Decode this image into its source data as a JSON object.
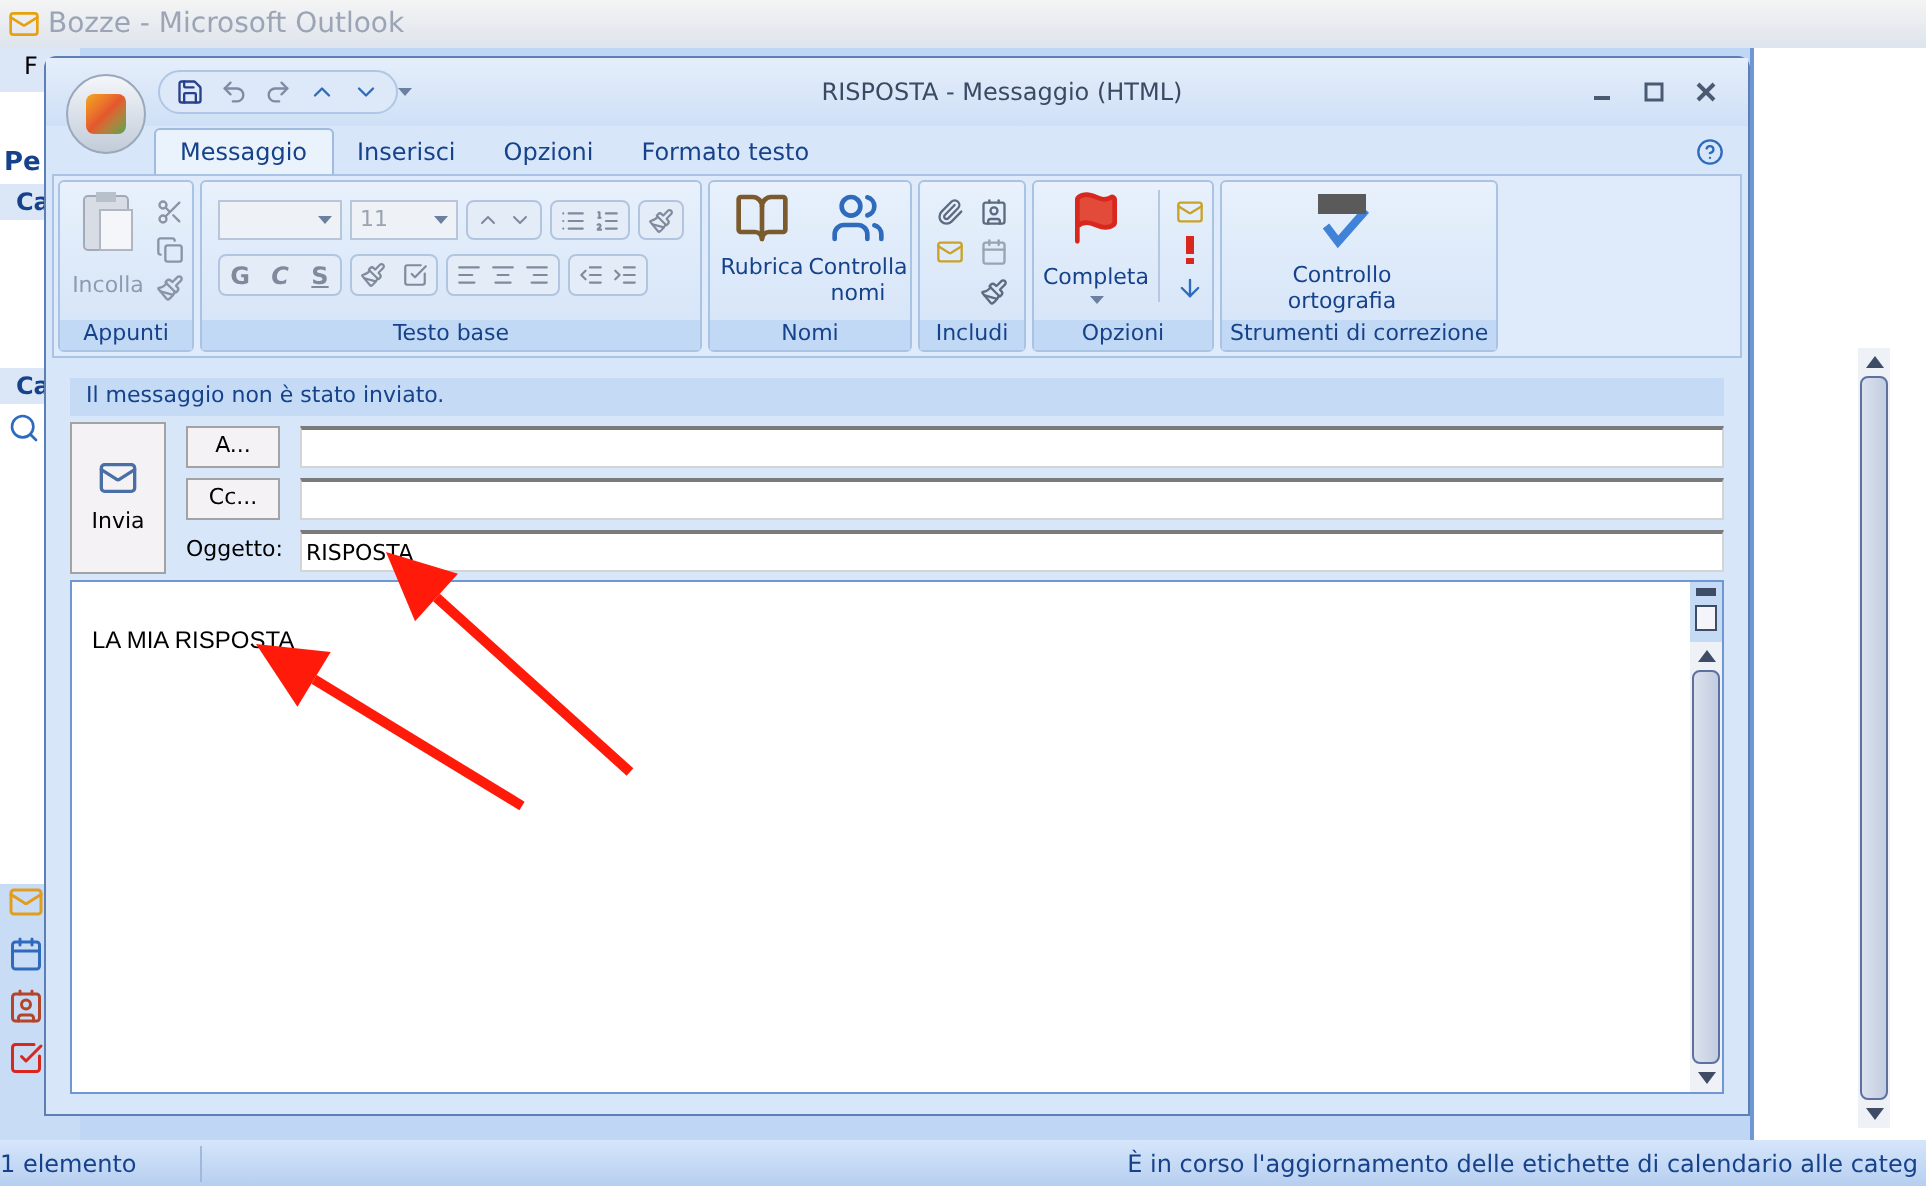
{
  "outlook": {
    "title": "Bozze - Microsoft Outlook",
    "fragments": [
      "F",
      "Pe",
      "Ca",
      "Ca"
    ],
    "status_left": "1 elemento",
    "status_right": "È in corso l'aggiornamento delle etichette di calendario alle categ"
  },
  "message_window": {
    "title": "RISPOSTA - Messaggio (HTML)",
    "tabs": [
      {
        "label": "Messaggio",
        "selected": true
      },
      {
        "label": "Inserisci",
        "selected": false
      },
      {
        "label": "Opzioni",
        "selected": false
      },
      {
        "label": "Formato testo",
        "selected": false
      }
    ],
    "groups": [
      {
        "kind": "clipboard",
        "label": "Appunti",
        "paste": {
          "label": "Incolla",
          "disabled": true
        }
      },
      {
        "kind": "font",
        "label": "Testo base",
        "font_size": "11",
        "styles": [
          "G",
          "C",
          "S"
        ]
      },
      {
        "kind": "names",
        "label": "Nomi",
        "buttons": [
          "Rubrica",
          "Controlla nomi"
        ]
      },
      {
        "kind": "include",
        "label": "Includi"
      },
      {
        "kind": "options",
        "label": "Opzioni",
        "button": "Completa"
      },
      {
        "kind": "proofing",
        "label": "Strumenti di correzione",
        "button": "Controllo ortografia"
      }
    ],
    "infobar": "Il messaggio non è stato inviato.",
    "send": "Invia",
    "to": {
      "label": "A..."
    },
    "cc": {
      "label": "Cc..."
    },
    "subject": {
      "label": "Oggetto:",
      "value": "RISPOSTA"
    },
    "body": "LA MIA RISPOSTA"
  }
}
